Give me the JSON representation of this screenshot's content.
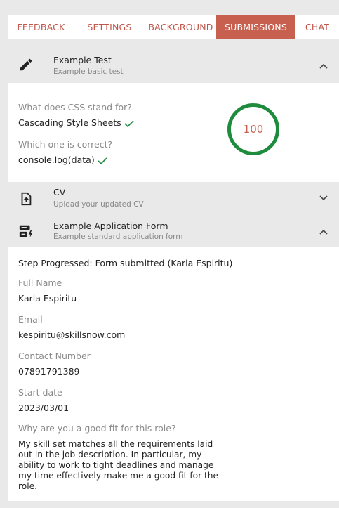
{
  "tabs": [
    {
      "label": "FEEDBACK",
      "active": false
    },
    {
      "label": "SETTINGS",
      "active": false
    },
    {
      "label": "BACKGROUND",
      "active": false
    },
    {
      "label": "SUBMISSIONS",
      "active": true
    },
    {
      "label": "CHAT",
      "active": false
    }
  ],
  "sections": {
    "example_test": {
      "icon": "pencil-icon",
      "title": "Example Test",
      "subtitle": "Example basic test",
      "expanded": true,
      "score": "100",
      "questions": [
        {
          "question": "What does CSS stand for?",
          "answer": "Cascading Style Sheets",
          "correct": true
        },
        {
          "question": "Which one is correct?",
          "answer": "console.log(data)",
          "correct": true
        }
      ]
    },
    "cv": {
      "icon": "upload-file-icon",
      "title": "CV",
      "subtitle": "Upload your updated CV",
      "expanded": false
    },
    "application_form": {
      "icon": "form-icon",
      "title": "Example Application Form",
      "subtitle": "Example standard application form",
      "expanded": true,
      "step": "Step Progressed: Form submitted (Karla Espiritu)",
      "fields": [
        {
          "label": "Full Name",
          "value": "Karla Espiritu"
        },
        {
          "label": "Email",
          "value": "kespiritu@skillsnow.com"
        },
        {
          "label": "Contact Number",
          "value": "07891791389"
        },
        {
          "label": "Start date",
          "value": "2023/03/01"
        },
        {
          "label": "Why are you a good fit for this role?",
          "value": "My skill set matches all the requirements laid out in the job description. In particular, my ability to work to tight deadlines and manage my time effectively make me a good fit for the role."
        }
      ]
    }
  },
  "colors": {
    "accent": "#c8604f",
    "success": "#1f8b3d",
    "muted": "#8a8a8a",
    "header_bg": "#e9e9e9"
  }
}
